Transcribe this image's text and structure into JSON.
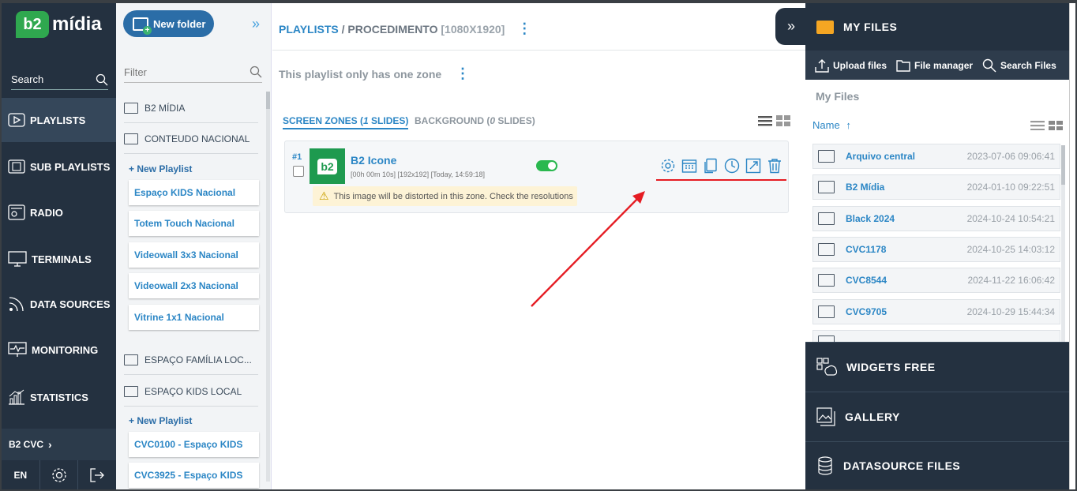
{
  "app": {
    "logo_mark": "b2",
    "logo_text": "mídia"
  },
  "nav": {
    "search_placeholder": "Search",
    "items": [
      {
        "label": "PLAYLISTS",
        "active": true
      },
      {
        "label": "SUB PLAYLISTS"
      },
      {
        "label": "RADIO"
      },
      {
        "label": "TERMINALS"
      },
      {
        "label": "DATA SOURCES"
      },
      {
        "label": "MONITORING"
      },
      {
        "label": "STATISTICS"
      }
    ],
    "account": "B2 CVC",
    "language": "EN"
  },
  "folders": {
    "new_folder": "New folder",
    "filter_placeholder": "Filter",
    "items": [
      {
        "name": "B2 MÍDIA"
      },
      {
        "name": "CONTEUDO NACIONAL"
      }
    ],
    "new_playlist": "+ New Playlist",
    "playlists_1": [
      "Espaço KIDS Nacional",
      "Totem Touch Nacional",
      "Videowall 3x3 Nacional",
      "Videowall 2x3 Nacional",
      "Vitrine 1x1 Nacional"
    ],
    "items_2": [
      {
        "name": "ESPAÇO FAMÍLIA LOC..."
      },
      {
        "name": "ESPAÇO KIDS LOCAL"
      }
    ],
    "playlists_2": [
      "CVC0100 - Espaço KIDS",
      "CVC3925 - Espaço KIDS"
    ]
  },
  "main": {
    "crumb_root": "PLAYLISTS",
    "crumb_sep": "/",
    "crumb_name": "PROCEDIMENTO",
    "crumb_res": "[1080X1920]",
    "zone_text": "This playlist only has one zone",
    "tab_zones_prefix": "SCREEN ZONES (",
    "tab_zones_count": "1",
    "tab_zones_suffix": " SLIDES)",
    "tab_bg_prefix": "BACKGROUND (",
    "tab_bg_count": "0",
    "tab_bg_suffix": " SLIDES)",
    "slide": {
      "number": "#1",
      "thumb_text": "b2",
      "name": "B2 Icone",
      "meta": "[00h 00m 10s] [192x192] [Today, 14:59:18]",
      "enabled": true,
      "warning": "This image will be distorted in this zone. Check the resolutions"
    }
  },
  "right": {
    "title": "MY FILES",
    "toolbar": [
      "Upload files",
      "File manager",
      "Search Files"
    ],
    "section_label": "My Files",
    "sort_label": "Name",
    "files": [
      {
        "name": "Arquivo central",
        "date": "2023-07-06 09:06:41"
      },
      {
        "name": "B2 Mídia",
        "date": "2024-01-10 09:22:51"
      },
      {
        "name": "Black 2024",
        "date": "2024-10-24 10:54:21"
      },
      {
        "name": "CVC1178",
        "date": "2024-10-25 14:03:12"
      },
      {
        "name": "CVC8544",
        "date": "2024-11-22 16:06:42"
      },
      {
        "name": "CVC9705",
        "date": "2024-10-29 15:44:34"
      }
    ],
    "sections": [
      "WIDGETS FREE",
      "GALLERY",
      "DATASOURCE FILES"
    ]
  },
  "colors": {
    "nav_bg": "#243140",
    "accent": "#2b86c5",
    "toggle_on": "#2ab84f",
    "annotation": "#e51c23"
  }
}
